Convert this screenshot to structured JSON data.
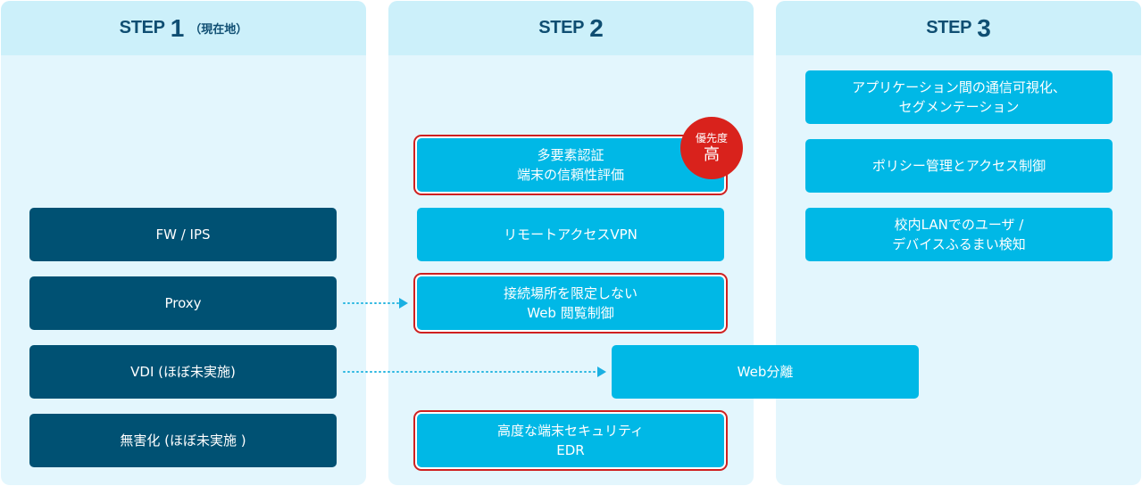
{
  "columns": [
    {
      "step": "STEP",
      "number": "1",
      "sub": "（現在地）"
    },
    {
      "step": "STEP",
      "number": "2",
      "sub": ""
    },
    {
      "step": "STEP",
      "number": "3",
      "sub": ""
    }
  ],
  "step1_items": [
    "FW / IPS",
    "Proxy",
    "VDI (ほぼ未実施)",
    "無害化 (ほぼ未実施 )"
  ],
  "step2_items": [
    {
      "label": "多要素認証\n端末の信頼性評価",
      "highlighted": true
    },
    {
      "label": "リモートアクセスVPN",
      "highlighted": false
    },
    {
      "label": "接続場所を限定しない\nWeb 閲覧制御",
      "highlighted": true
    },
    {
      "label": "高度な端末セキュリティ\nEDR",
      "highlighted": true
    }
  ],
  "spanning_item": "Web分離",
  "step3_items": [
    "アプリケーション間の通信可視化、\nセグメンテーション",
    "ポリシー管理とアクセス制御",
    "校内LANでのユーザ /\nデバイスふるまい検知"
  ],
  "priority_badge": {
    "line1": "優先度",
    "line2": "高"
  },
  "colors": {
    "column_bg": "#e3f6fd",
    "header_bg": "#ccf0fa",
    "header_text": "#0f4e72",
    "dark_box": "#005173",
    "light_box": "#00b8e6",
    "highlight_border": "#cf2020",
    "badge": "#d9221c"
  }
}
